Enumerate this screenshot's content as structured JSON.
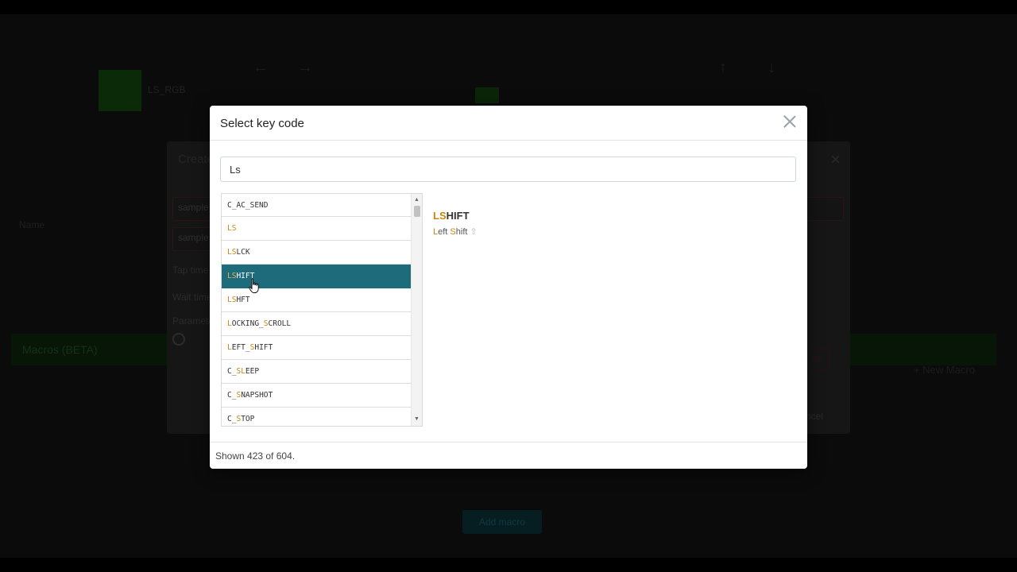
{
  "background": {
    "swatch_label": "LS_RGB",
    "name_label": "Name",
    "tap_time_label": "Tap time",
    "wait_time_label": "Wait time",
    "parameters_label": "Paramete",
    "sample_value_1": "sample",
    "sample_value_2": "sample",
    "create_title": "Create",
    "macros_label": "Macros (BETA)",
    "new_macro_label": "+ New Macro",
    "select_all_label": "e all",
    "cancel_label": "ncel",
    "bottom_button_label": "Add macro"
  },
  "modal": {
    "title": "Select key code",
    "search": {
      "value": "Ls",
      "placeholder": ""
    },
    "list": [
      {
        "pre": "C_AC_SEND",
        "hl": "",
        "post": "",
        "selected": false
      },
      {
        "pre": "",
        "hl": "LS",
        "post": "",
        "selected": false
      },
      {
        "pre": "",
        "hl": "LS",
        "post": "LCK",
        "selected": false
      },
      {
        "pre": "",
        "hl": "LS",
        "post": "HIFT",
        "selected": true
      },
      {
        "pre": "",
        "hl": "LS",
        "post": "HFT",
        "selected": false
      },
      {
        "pre": "",
        "hl": "L",
        "post": "OCKING_",
        "hl2": "S",
        "post2": "CROLL",
        "selected": false
      },
      {
        "pre": "",
        "hl": "L",
        "post": "EFT_",
        "hl2": "S",
        "post2": "HIFT",
        "selected": false
      },
      {
        "pre": "C_",
        "hl": "S",
        "post": "",
        "hl2": "L",
        "post2": "EEP",
        "selected": false
      },
      {
        "pre": "C_",
        "hl": "S",
        "post": "NAPSHOT",
        "selected": false
      },
      {
        "pre": "C_",
        "hl": "S",
        "post": "TOP",
        "selected": false
      }
    ],
    "detail": {
      "title_hl": "LS",
      "title_rest": "HIFT",
      "desc_hl1": "L",
      "desc_mid1": "eft ",
      "desc_hl2": "S",
      "desc_mid2": "hift",
      "desc_icon": "⇧"
    },
    "footer_status": "Shown 423 of 604."
  },
  "colors": {
    "accent": "#1e6b7c",
    "highlight": "#c7850f"
  },
  "icons": {
    "close": "close-icon",
    "scroll_up": "▲",
    "scroll_down": "▼"
  }
}
